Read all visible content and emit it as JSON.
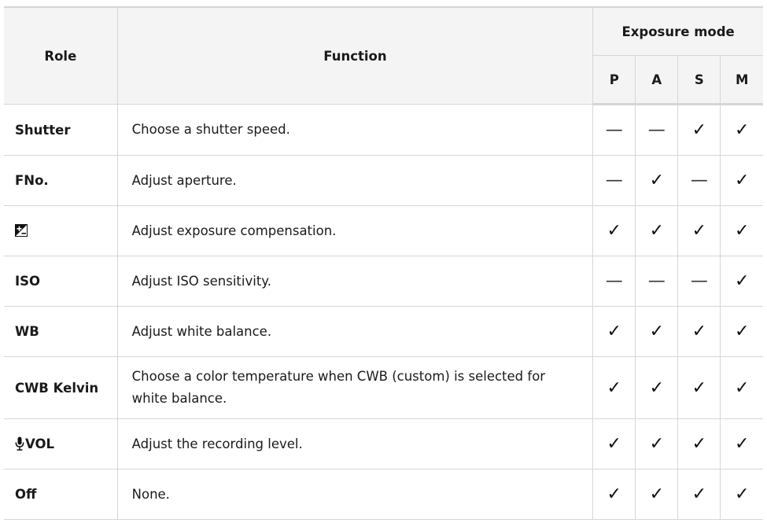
{
  "header": {
    "role": "Role",
    "function": "Function",
    "exposure_mode": "Exposure mode",
    "modes": [
      "P",
      "A",
      "S",
      "M"
    ]
  },
  "rows": [
    {
      "role": "Shutter",
      "function": "Choose a shutter speed.",
      "marks": [
        "—",
        "—",
        "✓",
        "✓"
      ]
    },
    {
      "role": "FNo.",
      "function": "Adjust aperture.",
      "marks": [
        "—",
        "✓",
        "—",
        "✓"
      ]
    },
    {
      "role": "",
      "role_icon": "exposure-compensation-icon",
      "function": "Adjust exposure compensation.",
      "marks": [
        "✓",
        "✓",
        "✓",
        "✓"
      ]
    },
    {
      "role": "ISO",
      "function": "Adjust ISO sensitivity.",
      "marks": [
        "—",
        "—",
        "—",
        "✓"
      ]
    },
    {
      "role": "WB",
      "function": "Adjust white balance.",
      "marks": [
        "✓",
        "✓",
        "✓",
        "✓"
      ]
    },
    {
      "role": "CWB Kelvin",
      "function": "Choose a color temperature when CWB (custom) is selected for white balance.",
      "marks": [
        "✓",
        "✓",
        "✓",
        "✓"
      ]
    },
    {
      "role": "VOL",
      "role_icon": "microphone-icon",
      "function": "Adjust the recording level.",
      "marks": [
        "✓",
        "✓",
        "✓",
        "✓"
      ]
    },
    {
      "role": "Off",
      "function": "None.",
      "marks": [
        "✓",
        "✓",
        "✓",
        "✓"
      ]
    }
  ]
}
